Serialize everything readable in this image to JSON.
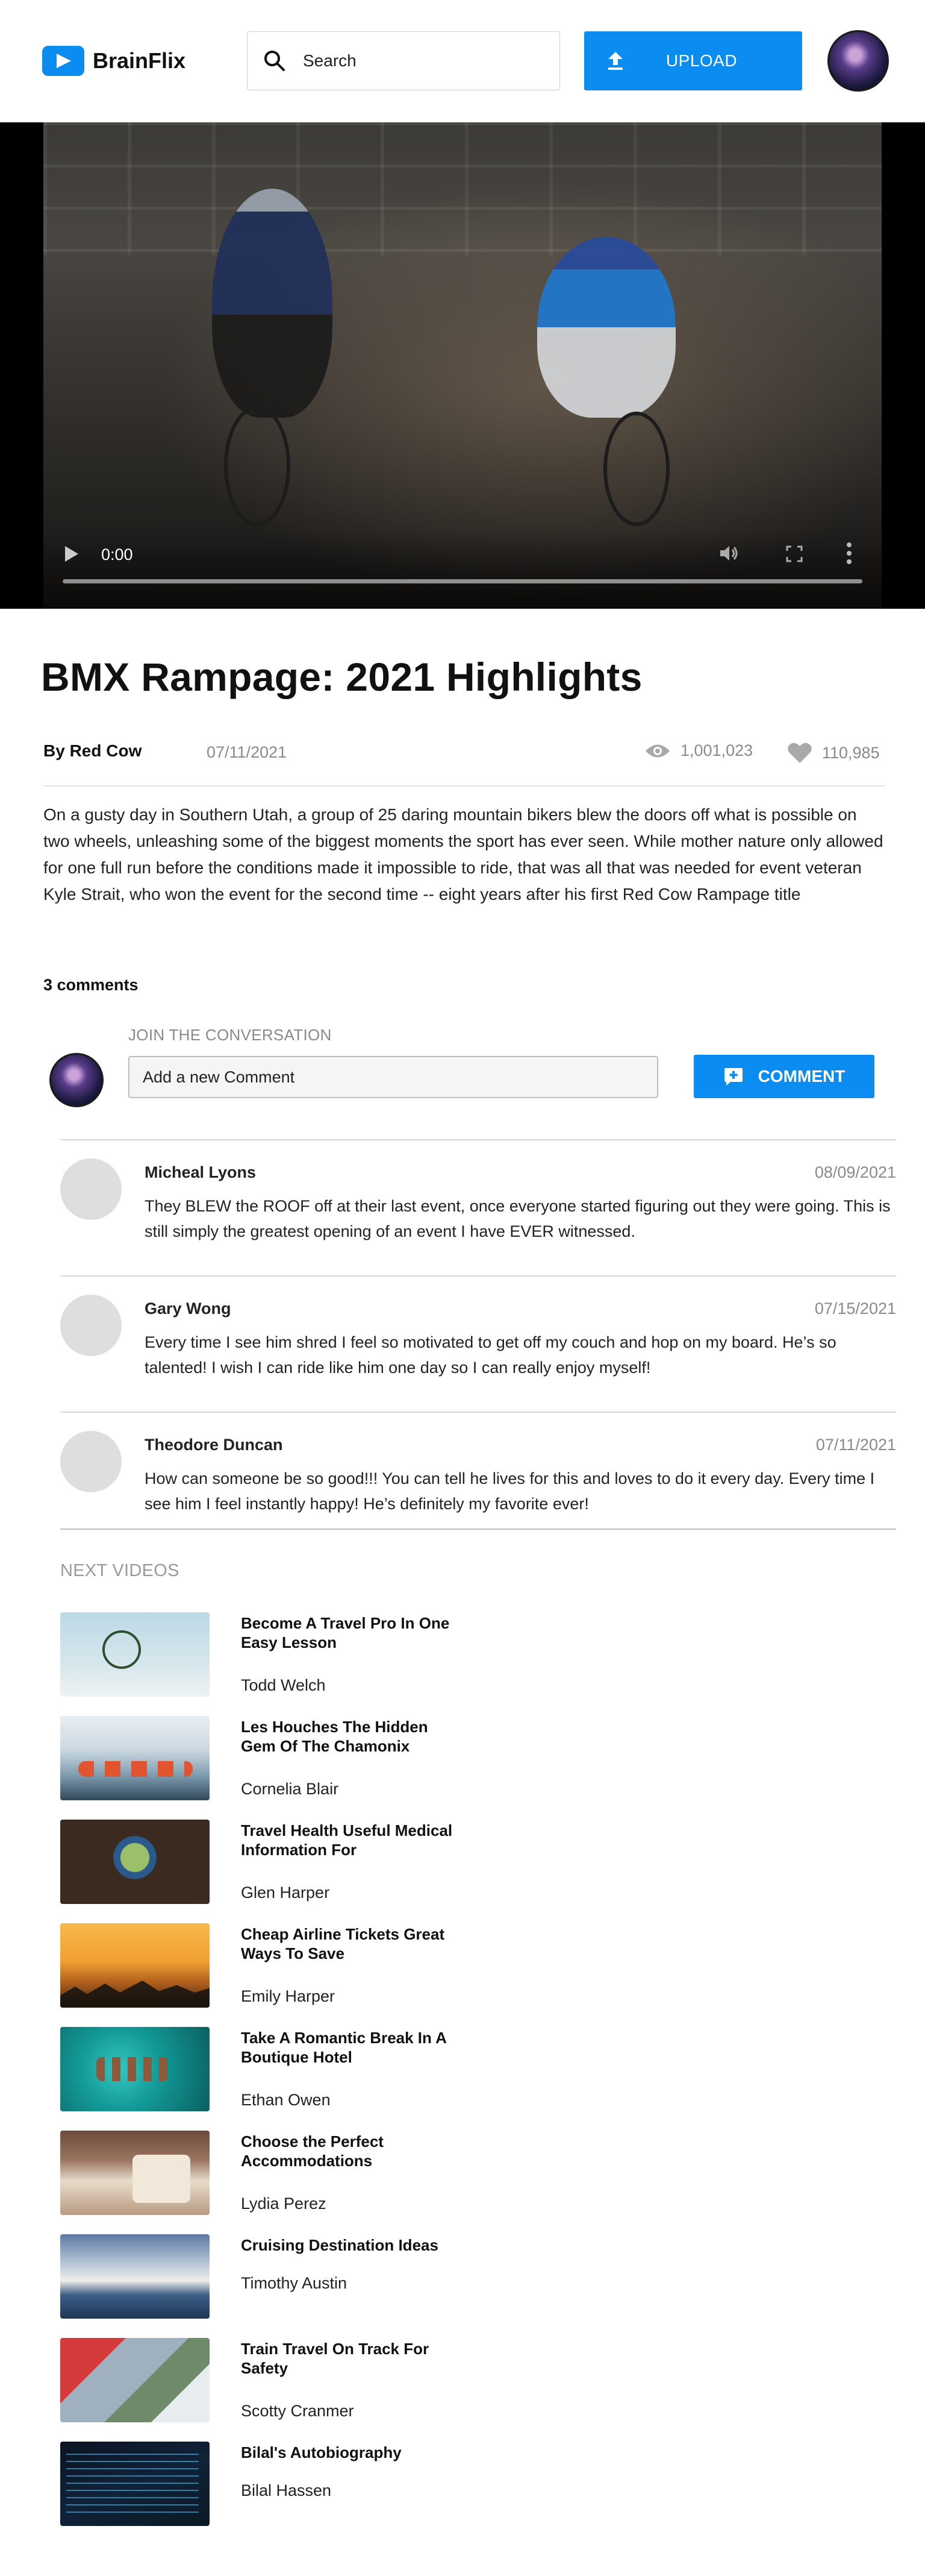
{
  "header": {
    "brand": "BrainFlix",
    "search_placeholder": "Search",
    "upload_label": "UPLOAD"
  },
  "video": {
    "current_time": "0:00"
  },
  "details": {
    "title": "BMX Rampage: 2021 Highlights",
    "author": "By Red Cow",
    "date": "07/11/2021",
    "views": "1,001,023",
    "likes": "110,985",
    "description": "On a gusty day in Southern Utah, a group of 25 daring mountain bikers blew the doors off what is possible on two wheels, unleashing some of the biggest moments the sport has ever seen. While mother nature only allowed for one full run before the conditions made it impossible to ride, that was all that was needed for event veteran Kyle Strait, who won the event for the second time -- eight years after his first Red Cow Rampage title"
  },
  "comments_section": {
    "count_label": "3 comments",
    "join_label": "JOIN THE CONVERSATION",
    "input_placeholder": "Add a new Comment",
    "button_label": "COMMENT",
    "comments": [
      {
        "name": "Micheal Lyons",
        "date": "08/09/2021",
        "text": "They BLEW the ROOF off at their last event, once everyone started figuring out they were going. This is still simply the greatest opening of an event I have EVER witnessed."
      },
      {
        "name": "Gary Wong",
        "date": "07/15/2021",
        "text": "Every time I see him shred I feel so motivated to get off my couch and hop on my board. He’s so talented! I wish I can ride like him one day so I can really enjoy myself!"
      },
      {
        "name": "Theodore Duncan",
        "date": "07/11/2021",
        "text": "How can someone be so good!!! You can tell he lives for this and loves to do it every day. Every time I see him I feel instantly happy! He’s definitely my favorite ever!"
      }
    ]
  },
  "next_videos": {
    "label": "NEXT VIDEOS",
    "items": [
      {
        "title": "Become A Travel Pro In One Easy Lesson",
        "author": "Todd Welch"
      },
      {
        "title": "Les Houches The Hidden Gem Of The Chamonix",
        "author": "Cornelia Blair"
      },
      {
        "title": "Travel Health Useful Medical Information For",
        "author": "Glen Harper"
      },
      {
        "title": "Cheap Airline Tickets Great Ways To Save",
        "author": "Emily Harper"
      },
      {
        "title": "Take A Romantic Break In A Boutique Hotel",
        "author": "Ethan Owen"
      },
      {
        "title": "Choose the Perfect Accommodations",
        "author": "Lydia Perez"
      },
      {
        "title": "Cruising Destination Ideas",
        "author": "Timothy Austin"
      },
      {
        "title": "Train Travel On Track For Safety",
        "author": "Scotty Cranmer"
      },
      {
        "title": "Bilal's Autobiography",
        "author": "Bilal Hassen"
      }
    ]
  },
  "colors": {
    "accent": "#0b8cf0",
    "muted_text": "#8a8a8a",
    "divider": "#d8d8d8"
  },
  "icons": [
    "play-logo-icon",
    "search-icon",
    "upload-icon",
    "play-icon",
    "volume-icon",
    "fullscreen-icon",
    "more-icon",
    "eye-icon",
    "heart-icon",
    "add-comment-icon"
  ]
}
